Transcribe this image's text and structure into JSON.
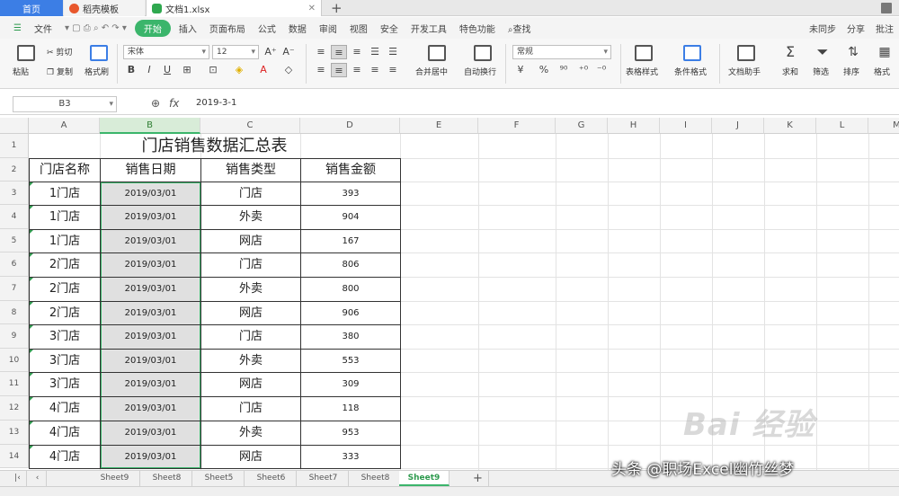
{
  "titlebar": {
    "tabs": [
      {
        "label": "首页",
        "color": "#3c7ee5"
      },
      {
        "label": "稻壳模板",
        "color": "#e8572c"
      },
      {
        "label": "文档1.xlsx",
        "color": "#2fa84f"
      }
    ],
    "new_tab": "+"
  },
  "menubar": {
    "file": "文件",
    "items": [
      "开始",
      "插入",
      "页面布局",
      "公式",
      "数据",
      "审阅",
      "视图",
      "安全",
      "开发工具",
      "特色功能"
    ],
    "active": "开始",
    "search": "查找",
    "right": [
      "未同步",
      "分享",
      "批注"
    ]
  },
  "ribbon": {
    "paste": "粘贴",
    "cut": "剪切",
    "copy": "复制",
    "format_painter": "格式刷",
    "font": "宋体",
    "font_size": "12",
    "merge_center": "合并居中",
    "wrap": "自动换行",
    "number_format": "常规",
    "table_style": "表格样式",
    "cond_format": "条件格式",
    "doc_helper": "文档助手",
    "sum": "求和",
    "filter": "筛选",
    "sort": "排序",
    "format": "格式"
  },
  "formula_bar": {
    "name_box": "B3",
    "value": "2019-3-1"
  },
  "sheet": {
    "columns": [
      "A",
      "B",
      "C",
      "D",
      "E",
      "F",
      "G",
      "H",
      "I",
      "J",
      "K",
      "L",
      "M"
    ],
    "rows": [
      "1",
      "2",
      "3",
      "4",
      "5",
      "6",
      "7",
      "8",
      "9",
      "10",
      "11",
      "12",
      "13",
      "14"
    ],
    "title": "门店销售数据汇总表",
    "headers": [
      "门店名称",
      "销售日期",
      "销售类型",
      "销售金额"
    ],
    "data": [
      [
        "1门店",
        "2019/03/01",
        "门店",
        "393"
      ],
      [
        "1门店",
        "2019/03/01",
        "外卖",
        "904"
      ],
      [
        "1门店",
        "2019/03/01",
        "网店",
        "167"
      ],
      [
        "2门店",
        "2019/03/01",
        "门店",
        "806"
      ],
      [
        "2门店",
        "2019/03/01",
        "外卖",
        "800"
      ],
      [
        "2门店",
        "2019/03/01",
        "网店",
        "906"
      ],
      [
        "3门店",
        "2019/03/01",
        "门店",
        "380"
      ],
      [
        "3门店",
        "2019/03/01",
        "外卖",
        "553"
      ],
      [
        "3门店",
        "2019/03/01",
        "网店",
        "309"
      ],
      [
        "4门店",
        "2019/03/01",
        "门店",
        "118"
      ],
      [
        "4门店",
        "2019/03/01",
        "外卖",
        "953"
      ],
      [
        "4门店",
        "2019/03/01",
        "网店",
        "333"
      ]
    ]
  },
  "sheet_tabs": {
    "tabs": [
      "Sheet9",
      "Sheet8",
      "Sheet5",
      "Sheet6",
      "Sheet7",
      "Sheet8",
      "Sheet9"
    ],
    "active_index": 6,
    "add": "+"
  },
  "overlay": {
    "watermark": "头条 @职场Excel幽竹丝梦",
    "baidu": "Bai 经验"
  },
  "colors": {
    "accent": "#3bb56b",
    "home_tab": "#3c7ee5",
    "selection_fill": "#e0e0e0"
  }
}
